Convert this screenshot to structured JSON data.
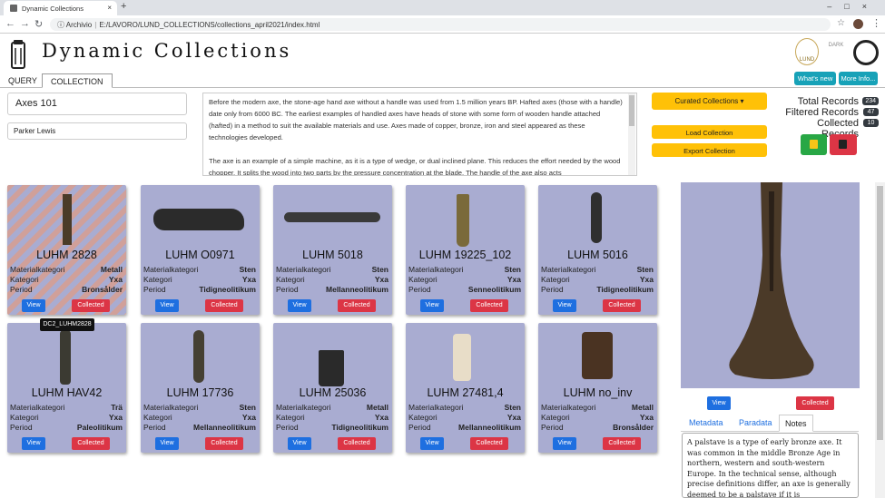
{
  "browser": {
    "tab_title": "Dynamic Collections",
    "tab_close": "×",
    "new_tab": "+",
    "window_controls": "–□×",
    "address_scheme": "Archivio",
    "address_url": "E:/LAVORO/LUND_COLLECTIONS/collections_april2021/index.html"
  },
  "header": {
    "title": "Dynamic Collections",
    "lund_logo": "LUND",
    "dark_logo": "DARK",
    "whats_new": "What's new",
    "more_info": "More Info..."
  },
  "tabs": [
    "QUERY",
    "COLLECTION"
  ],
  "collection": {
    "name": "Axes 101",
    "author": "Parker Lewis",
    "description_p1": "Before the modern axe, the stone-age hand axe without a handle was used from 1.5 million years BP. Hafted axes (those with a handle) date only from 6000 BC. The earliest examples of handled axes have heads of stone with some form of wooden handle attached (hafted) in a method to suit the available materials and use. Axes made of copper, bronze, iron and steel appeared as these technologies developed.",
    "description_p2": "The axe is an example of a simple machine, as it is a type of wedge, or dual inclined plane. This reduces the effort needed by the wood chopper. It splits the wood into two parts by the pressure concentration at the blade. The handle of the axe also acts"
  },
  "actions": {
    "curated": "Curated Collections",
    "load": "Load Collection",
    "export": "Export Collection"
  },
  "records": {
    "total_label": "Total Records",
    "total": "234",
    "filtered_label": "Filtered Records",
    "filtered": "47",
    "collected_label": "Collected Records",
    "collected": "10"
  },
  "labels": {
    "material": "Materialkategori",
    "category": "Kategori",
    "period": "Period",
    "view": "View",
    "collected": "Collected"
  },
  "cards": [
    {
      "title": "LUHM 2828",
      "material": "Metall",
      "category": "Yxa",
      "period": "Bronsålder"
    },
    {
      "title": "LUHM O0971",
      "material": "Sten",
      "category": "Yxa",
      "period": "Tidigneolitikum"
    },
    {
      "title": "LUHM 5018",
      "material": "Sten",
      "category": "Yxa",
      "period": "Mellanneolitikum"
    },
    {
      "title": "LUHM 19225_102",
      "material": "Sten",
      "category": "Yxa",
      "period": "Senneolitikum"
    },
    {
      "title": "LUHM 5016",
      "material": "Sten",
      "category": "Yxa",
      "period": "Tidigneolitikum"
    },
    {
      "title": "LUHM HAV42",
      "material": "Trä",
      "category": "Yxa",
      "period": "Paleolitikum"
    },
    {
      "title": "LUHM 17736",
      "material": "Sten",
      "category": "Yxa",
      "period": "Mellanneolitikum"
    },
    {
      "title": "LUHM 25036",
      "material": "Metall",
      "category": "Yxa",
      "period": "Tidigneolitikum"
    },
    {
      "title": "LUHM 27481,4",
      "material": "Sten",
      "category": "Yxa",
      "period": "Mellanneolitikum"
    },
    {
      "title": "LUHM no_inv",
      "material": "Metall",
      "category": "Yxa",
      "period": "Bronsålder"
    }
  ],
  "tooltip": "DC2_LUHM2828",
  "detail": {
    "tabs": [
      "Metadata",
      "Paradata",
      "Notes"
    ],
    "notes": "A palstave is a type of early bronze axe. It was common in the middle Bronze Age in northern, western and south-western Europe. In the technical sense, although precise definitions differ, an axe is generally deemed to be a palstave if it is"
  },
  "colors": {
    "card": "#a9acd1",
    "view": "#1e6fe0",
    "collected": "#dc3545",
    "accent": "#ffc107",
    "info": "#17a2b8"
  }
}
